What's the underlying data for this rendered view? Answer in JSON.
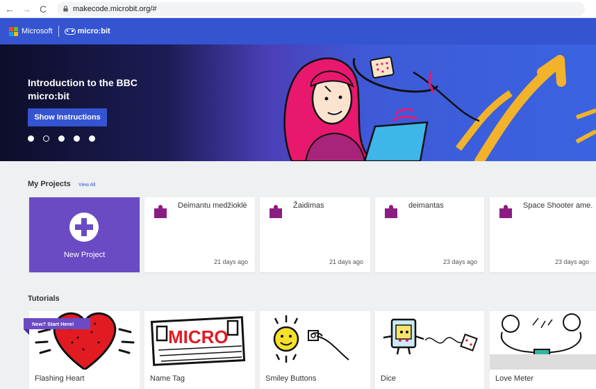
{
  "browser": {
    "url": "makecode.microbit.org/#"
  },
  "header": {
    "ms_text": "Microsoft",
    "brand": "micro:bit"
  },
  "hero": {
    "title": "Introduction to the BBC micro:bit",
    "button": "Show Instructions",
    "slide_count": 5,
    "active_slide": 2
  },
  "projects": {
    "heading": "My Projects",
    "view_all": "View All",
    "new_label": "New Project",
    "items": [
      {
        "title": "Deimantu medžioklė",
        "time": "21 days ago"
      },
      {
        "title": "Žaidimas",
        "time": "21 days ago"
      },
      {
        "title": "deimantas",
        "time": "23 days ago"
      },
      {
        "title": "Space Shooter ame.",
        "time": "23 days ago"
      }
    ]
  },
  "tutorials": {
    "heading": "Tutorials",
    "badge": "New? Start Here!",
    "items": [
      {
        "label": "Flashing Heart"
      },
      {
        "label": "Name Tag",
        "art_text": "MICRO"
      },
      {
        "label": "Smiley Buttons"
      },
      {
        "label": "Dice"
      },
      {
        "label": "Love Meter"
      }
    ]
  },
  "colors": {
    "brand_blue": "#3454d1",
    "purple": "#6a4bc3",
    "puzzle": "#8b1d82"
  }
}
